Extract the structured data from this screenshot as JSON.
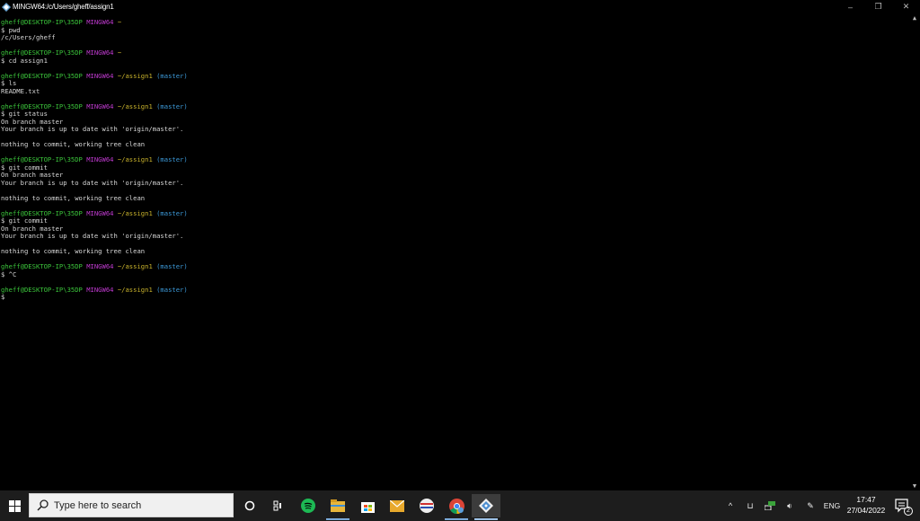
{
  "window": {
    "title": "MINGW64:/c/Users/gheff/assign1",
    "controls": {
      "minimize": "–",
      "restore": "❐",
      "close": "✕"
    }
  },
  "terminal": {
    "lines": [
      [
        {
          "t": "gheff@DESKTOP-IP\\35DP",
          "c": "u"
        },
        {
          "t": " "
        },
        {
          "t": "MINGW64",
          "c": "s"
        },
        {
          "t": " "
        },
        {
          "t": "~",
          "c": "p"
        }
      ],
      [
        {
          "t": "$ pwd"
        }
      ],
      [
        {
          "t": "/c/Users/gheff"
        }
      ],
      [
        {
          "t": ""
        }
      ],
      [
        {
          "t": "gheff@DESKTOP-IP\\35DP",
          "c": "u"
        },
        {
          "t": " "
        },
        {
          "t": "MINGW64",
          "c": "s"
        },
        {
          "t": " "
        },
        {
          "t": "~",
          "c": "p"
        }
      ],
      [
        {
          "t": "$ cd assign1"
        }
      ],
      [
        {
          "t": ""
        }
      ],
      [
        {
          "t": "gheff@DESKTOP-IP\\35DP",
          "c": "u"
        },
        {
          "t": " "
        },
        {
          "t": "MINGW64",
          "c": "s"
        },
        {
          "t": " "
        },
        {
          "t": "~/assign1",
          "c": "p"
        },
        {
          "t": " (master)",
          "c": "b"
        }
      ],
      [
        {
          "t": "$ ls"
        }
      ],
      [
        {
          "t": "README.txt"
        }
      ],
      [
        {
          "t": ""
        }
      ],
      [
        {
          "t": "gheff@DESKTOP-IP\\35DP",
          "c": "u"
        },
        {
          "t": " "
        },
        {
          "t": "MINGW64",
          "c": "s"
        },
        {
          "t": " "
        },
        {
          "t": "~/assign1",
          "c": "p"
        },
        {
          "t": " (master)",
          "c": "b"
        }
      ],
      [
        {
          "t": "$ git status"
        }
      ],
      [
        {
          "t": "On branch master"
        }
      ],
      [
        {
          "t": "Your branch is up to date with 'origin/master'."
        }
      ],
      [
        {
          "t": ""
        }
      ],
      [
        {
          "t": "nothing to commit, working tree clean"
        }
      ],
      [
        {
          "t": ""
        }
      ],
      [
        {
          "t": "gheff@DESKTOP-IP\\35DP",
          "c": "u"
        },
        {
          "t": " "
        },
        {
          "t": "MINGW64",
          "c": "s"
        },
        {
          "t": " "
        },
        {
          "t": "~/assign1",
          "c": "p"
        },
        {
          "t": " (master)",
          "c": "b"
        }
      ],
      [
        {
          "t": "$ git commit"
        }
      ],
      [
        {
          "t": "On branch master"
        }
      ],
      [
        {
          "t": "Your branch is up to date with 'origin/master'."
        }
      ],
      [
        {
          "t": ""
        }
      ],
      [
        {
          "t": "nothing to commit, working tree clean"
        }
      ],
      [
        {
          "t": ""
        }
      ],
      [
        {
          "t": "gheff@DESKTOP-IP\\35DP",
          "c": "u"
        },
        {
          "t": " "
        },
        {
          "t": "MINGW64",
          "c": "s"
        },
        {
          "t": " "
        },
        {
          "t": "~/assign1",
          "c": "p"
        },
        {
          "t": " (master)",
          "c": "b"
        }
      ],
      [
        {
          "t": "$ git commit"
        }
      ],
      [
        {
          "t": "On branch master"
        }
      ],
      [
        {
          "t": "Your branch is up to date with 'origin/master'."
        }
      ],
      [
        {
          "t": ""
        }
      ],
      [
        {
          "t": "nothing to commit, working tree clean"
        }
      ],
      [
        {
          "t": ""
        }
      ],
      [
        {
          "t": "gheff@DESKTOP-IP\\35DP",
          "c": "u"
        },
        {
          "t": " "
        },
        {
          "t": "MINGW64",
          "c": "s"
        },
        {
          "t": " "
        },
        {
          "t": "~/assign1",
          "c": "p"
        },
        {
          "t": " (master)",
          "c": "b"
        }
      ],
      [
        {
          "t": "$ ^C"
        }
      ],
      [
        {
          "t": ""
        }
      ],
      [
        {
          "t": "gheff@DESKTOP-IP\\35DP",
          "c": "u"
        },
        {
          "t": " "
        },
        {
          "t": "MINGW64",
          "c": "s"
        },
        {
          "t": " "
        },
        {
          "t": "~/assign1",
          "c": "p"
        },
        {
          "t": " (master)",
          "c": "b"
        }
      ],
      [
        {
          "t": "$"
        }
      ]
    ]
  },
  "taskbar": {
    "search_placeholder": "Type here to search",
    "pinned": [
      "task-view-icon",
      "spotify-icon",
      "file-explorer-icon",
      "store-icon",
      "mail-icon",
      "browser-icon",
      "chrome-icon",
      "git-bash-icon"
    ],
    "tray": {
      "language": "ENG",
      "time": "17:47",
      "date": "27/04/2022",
      "notification_count": "2"
    }
  },
  "colors": {
    "user": "#3bc43b",
    "system": "#c03ad0",
    "path": "#c8b22c",
    "branch": "#3c99d8",
    "text": "#d8d8d8",
    "background": "#000000",
    "taskbar": "#1d1d1d"
  }
}
